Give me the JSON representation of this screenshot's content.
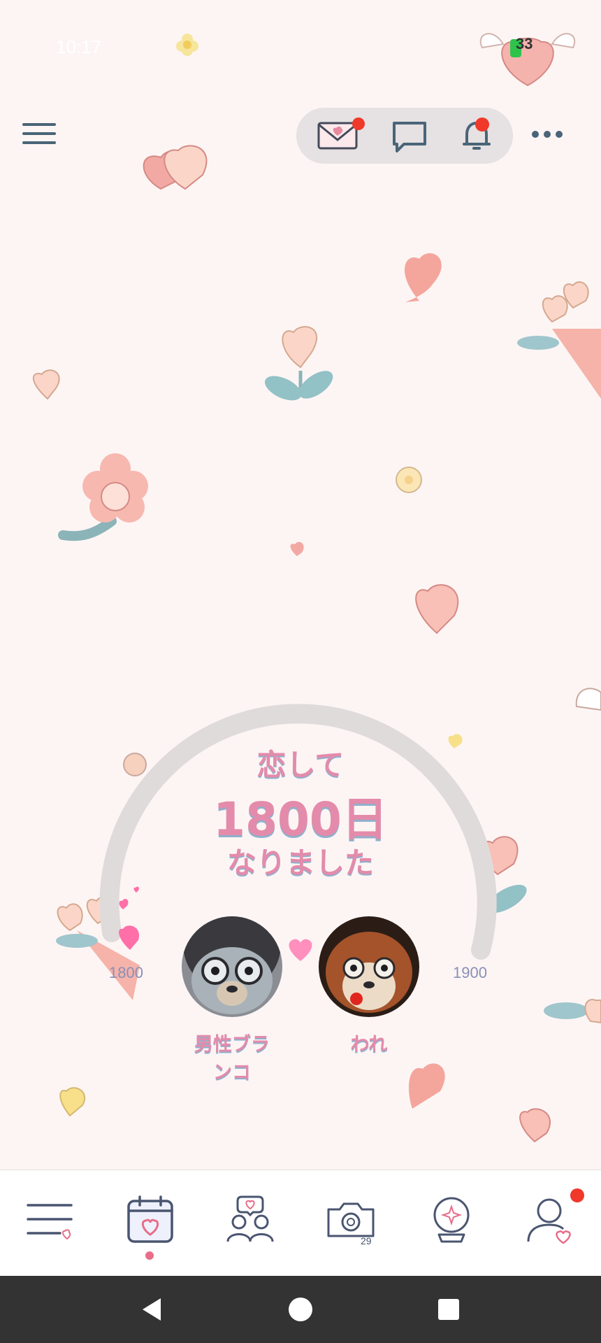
{
  "status_bar": {
    "time": "10:17",
    "battery": "33"
  },
  "top_bar": {
    "menu_icon": "hamburger-icon",
    "letter_icon": "love-letter-icon",
    "chat_icon": "chat-bubble-icon",
    "bell_icon": "bell-icon",
    "more_icon": "more-horizontal-icon"
  },
  "anniversary": {
    "prefix": "恋して",
    "days": "1800日",
    "suffix": "なりました",
    "progress_start": "1800",
    "progress_end": "1900",
    "progress_fraction": 0.0
  },
  "couple": {
    "partner_name": "男性ブランコ",
    "partner_name_line1": "男性ブラ",
    "partner_name_line2": "ンコ",
    "self_name": "われ"
  },
  "bottom_nav": {
    "items": [
      {
        "icon": "menu-heart-icon"
      },
      {
        "icon": "calendar-heart-icon",
        "selected": true
      },
      {
        "icon": "couple-chat-icon"
      },
      {
        "icon": "camera-29-icon",
        "badge_text": "29"
      },
      {
        "icon": "crystal-ball-icon"
      },
      {
        "icon": "profile-heart-icon",
        "badge": true
      }
    ]
  },
  "system_nav": {
    "back": "back-icon",
    "home": "home-icon",
    "recents": "recents-icon"
  },
  "colors": {
    "background": "#fdf5f4",
    "accent_pink": "#e48bab",
    "badge_red": "#f0382b",
    "icon_slate": "#4a6478"
  }
}
